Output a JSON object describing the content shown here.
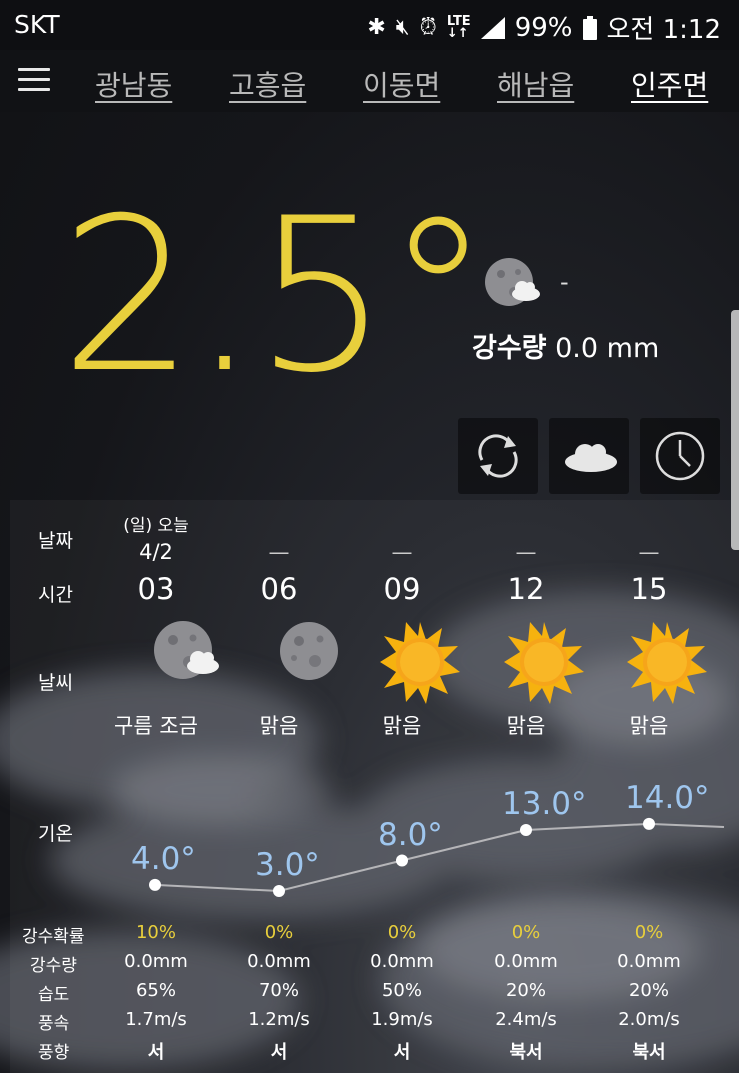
{
  "status_bar": {
    "carrier": "SKT",
    "battery": "99%",
    "time": "오전 1:12",
    "icons": [
      "bluetooth-icon",
      "mute-icon",
      "alarm-icon",
      "lte-icon",
      "signal-icon",
      "battery-icon"
    ]
  },
  "nav": {
    "tabs": [
      "광남동",
      "고흥읍",
      "이동면",
      "해남읍",
      "인주면"
    ],
    "active_tab": "인주면"
  },
  "current": {
    "temperature": "2.5°",
    "condition": "-",
    "precip_label": "강수량",
    "precip_value": "0.0 mm",
    "condition_icon": "moon-cloud-icon"
  },
  "actions": [
    "refresh-icon",
    "cloud-icon",
    "clock-icon"
  ],
  "forecast": {
    "row_labels": {
      "date": "날짜",
      "time": "시간",
      "weather": "날씨",
      "temp": "기온",
      "pop": "강수확률",
      "precip": "강수량",
      "humidity": "습도",
      "wind_speed": "풍속",
      "wind_dir": "풍향"
    },
    "first_day": "(일) 오늘",
    "first_date": "4/2",
    "dash": "—",
    "columns": [
      {
        "hour": "03",
        "icon": "moon-cloud-icon",
        "desc": "구름 조금",
        "temp": "4.0°",
        "temp_value": 4.0,
        "pop": "10%",
        "precip": "0.0mm",
        "humidity": "65%",
        "wind_speed": "1.7m/s",
        "wind_dir": "서"
      },
      {
        "hour": "06",
        "icon": "moon-icon",
        "desc": "맑음",
        "temp": "3.0°",
        "temp_value": 3.0,
        "pop": "0%",
        "precip": "0.0mm",
        "humidity": "70%",
        "wind_speed": "1.2m/s",
        "wind_dir": "서"
      },
      {
        "hour": "09",
        "icon": "sun-icon",
        "desc": "맑음",
        "temp": "8.0°",
        "temp_value": 8.0,
        "pop": "0%",
        "precip": "0.0mm",
        "humidity": "50%",
        "wind_speed": "1.9m/s",
        "wind_dir": "서"
      },
      {
        "hour": "12",
        "icon": "sun-icon",
        "desc": "맑음",
        "temp": "13.0°",
        "temp_value": 13.0,
        "pop": "0%",
        "precip": "0.0mm",
        "humidity": "20%",
        "wind_speed": "2.4m/s",
        "wind_dir": "북서"
      },
      {
        "hour": "15",
        "icon": "sun-icon",
        "desc": "맑음",
        "temp": "14.0°",
        "temp_value": 14.0,
        "pop": "0%",
        "precip": "0.0mm",
        "humidity": "20%",
        "wind_speed": "2.0m/s",
        "wind_dir": "북서"
      }
    ]
  },
  "colors": {
    "accent_yellow": "#e8cf3c",
    "temp_blue": "#9fc6ee"
  }
}
